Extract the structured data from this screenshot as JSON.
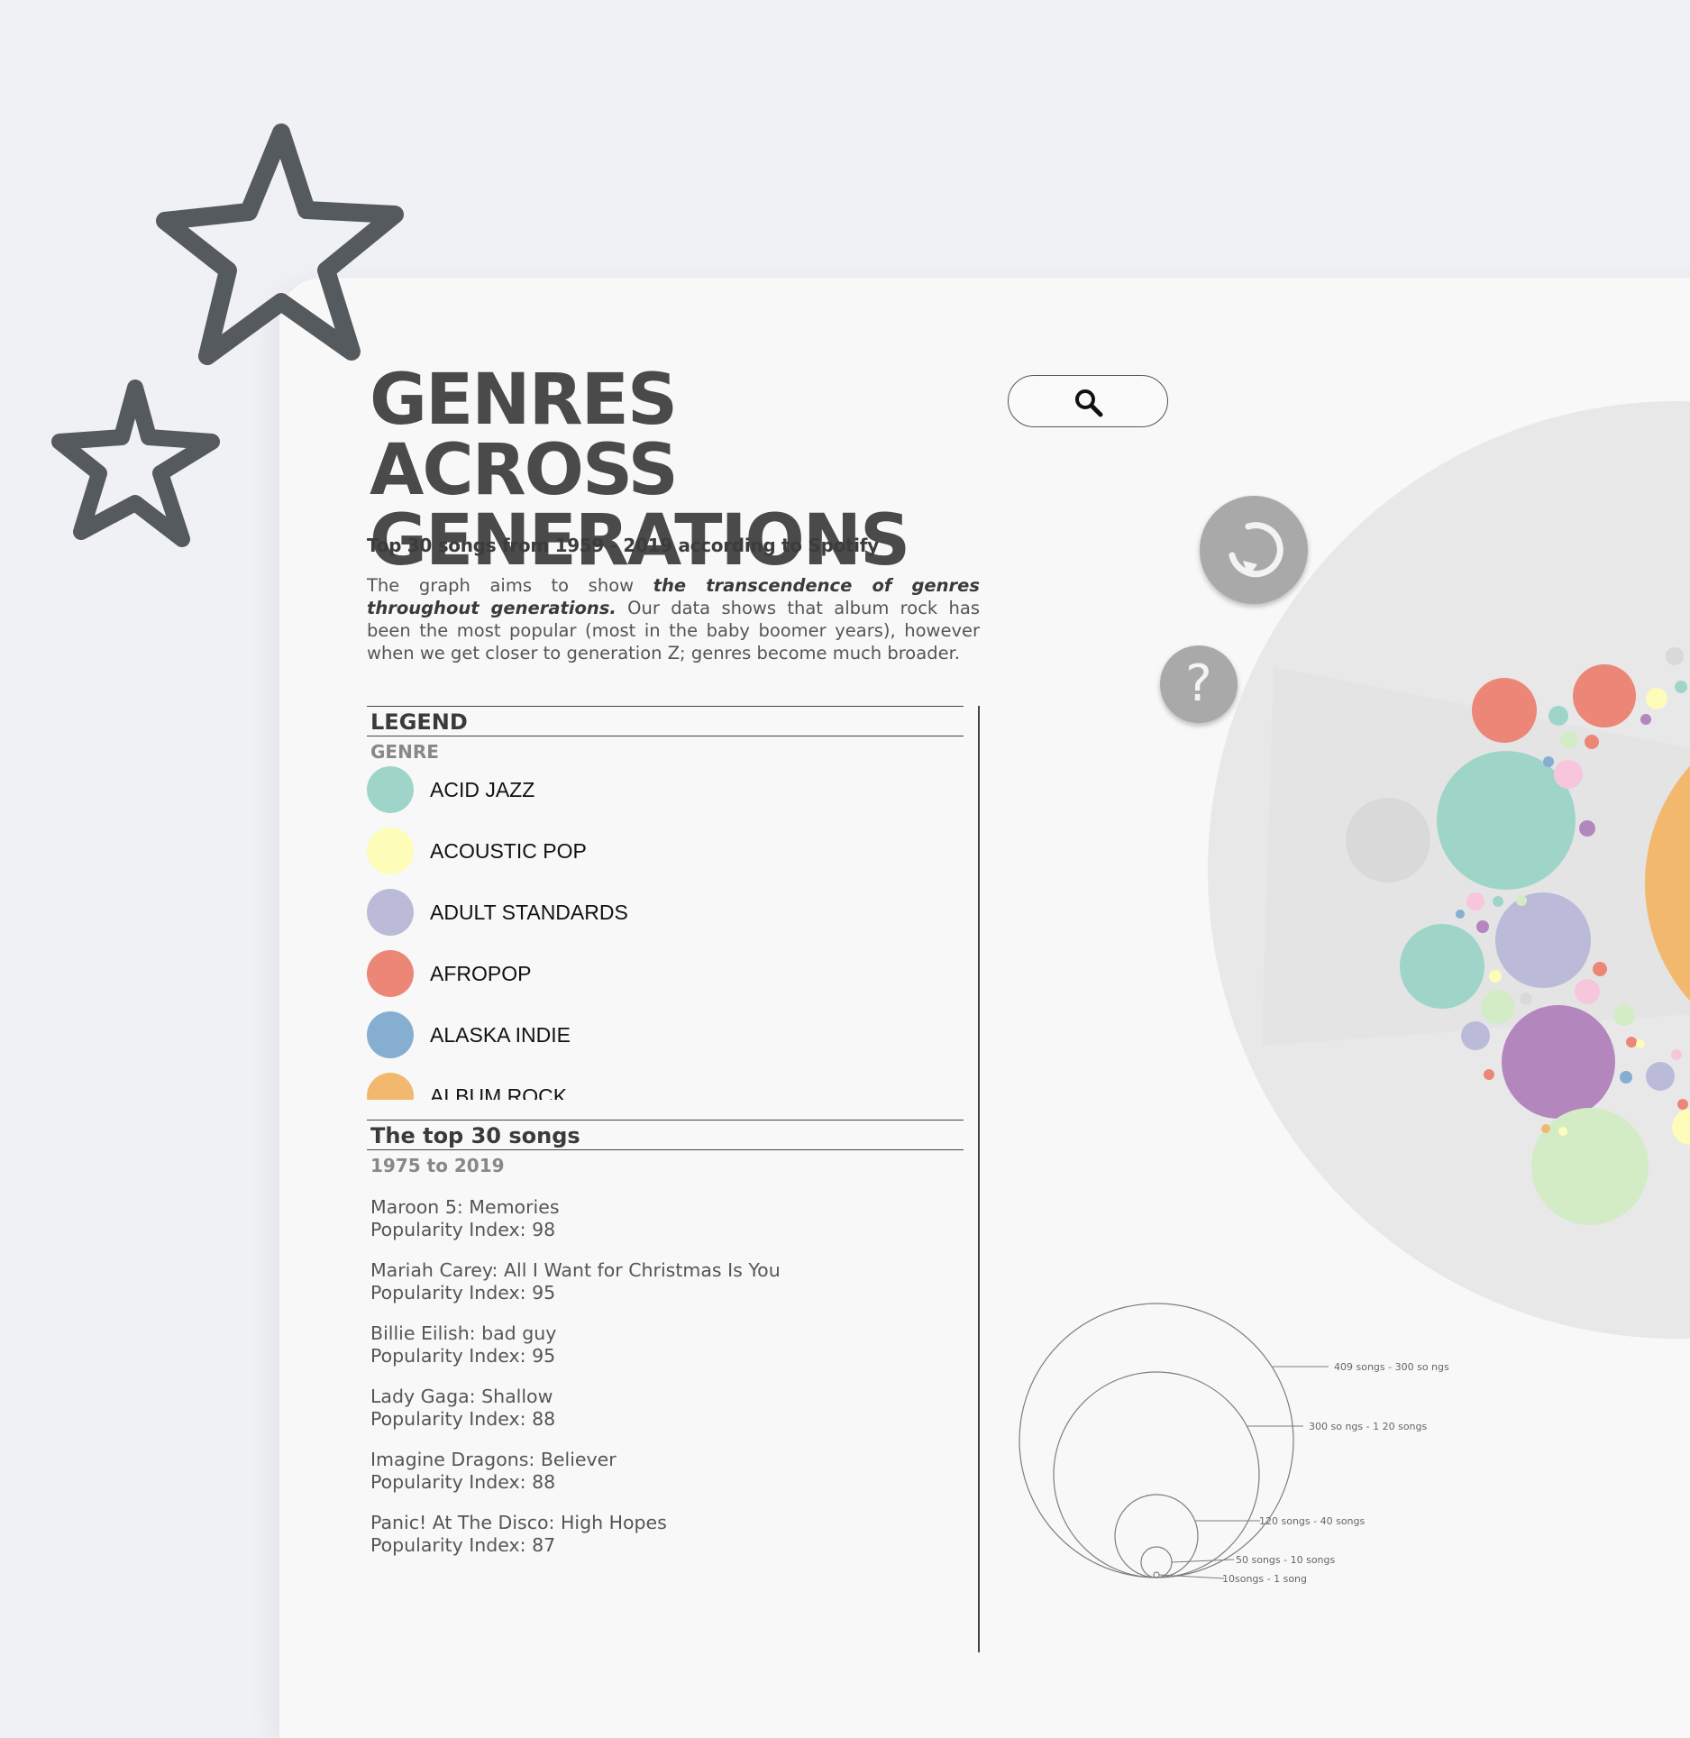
{
  "header": {
    "title_line1": "GENRES ACROSS",
    "title_line2": "GENERATIONS",
    "subtitle": "Top 30 songs from 1959 - 2019 according to Spotify"
  },
  "description": {
    "part1": "The graph aims to show ",
    "emphasis": "the transcendence of genres throughout generations.",
    "part2": " Our data shows that album rock has been the most popular (most in the baby boomer years), however when we get closer to generation Z; genres become much broader."
  },
  "search": {
    "icon": "search-icon"
  },
  "controls": {
    "reset_icon": "reset-icon",
    "help_label": "?"
  },
  "legend": {
    "heading": "LEGEND",
    "genre_label": "GENRE",
    "items": [
      {
        "label": "ACID JAZZ",
        "color": "#9fd5c8"
      },
      {
        "label": "ACOUSTIC POP",
        "color": "#fdfcb8"
      },
      {
        "label": "ADULT STANDARDS",
        "color": "#bcbad9"
      },
      {
        "label": "AFROPOP",
        "color": "#ec8677"
      },
      {
        "label": "ALASKA INDIE",
        "color": "#86aed1"
      },
      {
        "label": "ALBUM ROCK",
        "color": "#f2b86d"
      }
    ]
  },
  "songs": {
    "heading": "The top 30 songs",
    "range": "1975 to 2019",
    "items": [
      {
        "title": "Maroon 5: Memories",
        "popularity": "Popularity Index: 98"
      },
      {
        "title": "Mariah Carey: All I Want for Christmas Is You",
        "popularity": "Popularity Index: 95"
      },
      {
        "title": "Billie Eilish: bad guy",
        "popularity": "Popularity Index: 95"
      },
      {
        "title": "Lady Gaga: Shallow",
        "popularity": "Popularity Index: 88"
      },
      {
        "title": "Imagine Dragons: Believer",
        "popularity": "Popularity Index: 88"
      },
      {
        "title": "Panic! At The Disco: High Hopes",
        "popularity": "Popularity Index: 87"
      }
    ]
  },
  "size_legend": {
    "labels": [
      "409 songs - 300 so ngs",
      "300 so ngs - 1 20 songs",
      "120 songs - 40 songs",
      "50 songs - 10 songs",
      "10songs - 1 song"
    ]
  },
  "colors": {
    "acid_jazz": "#9fd5c8",
    "acoustic_pop": "#fdfcb8",
    "adult_standards": "#bcbad9",
    "afropop": "#ec8677",
    "alaska_indie": "#86aed1",
    "album_rock": "#f2b86d",
    "purple": "#b386bd",
    "light_green": "#d3ecc6",
    "grey": "#d9d9d9"
  }
}
